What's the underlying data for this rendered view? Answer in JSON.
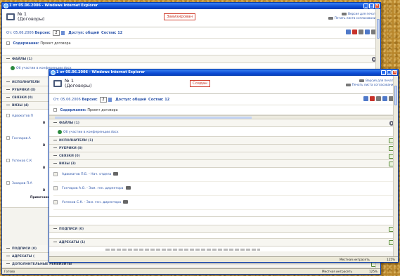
{
  "back_window": {
    "title": "1 от 05.06.2006 - Windows Internet Explorer",
    "doc_number": "№ 1",
    "doc_type": "(Договоры)",
    "status": "Завизирован",
    "print_version": "Версия для печати",
    "print_sheet": "Печать листа согласования",
    "meta_from": "От: 05.06.2006",
    "meta_version_label": "Версия:",
    "meta_version_value": "2",
    "meta_access": "Доступ: общий",
    "meta_composition": "Состав: 12",
    "content_label": "Содержание:",
    "content_value": "Проект договора",
    "files_header": "Файлы (1)",
    "file_name": "Об участии в конференции.docx",
    "left_sections": [
      "Исполнители",
      "Рубрики (0)",
      "Связки (0)",
      "Визы (4)"
    ],
    "left_visas": [
      "Адвокатов П",
      "Гончаров А",
      "Успехов С.К",
      "Захаров П.А"
    ],
    "left_visa_marks": [
      "В",
      "В",
      "В",
      "В"
    ],
    "left_visa_note": "Примечание",
    "bottom_sections": [
      "Подписи (0)",
      "Адресаты (",
      "Дополнительные реквизиты"
    ],
    "status_bar": "Готово",
    "zone": "Местная интрасеть",
    "zoom": "125%"
  },
  "front_window": {
    "title": "1 от 05.06.2006 - Windows Internet Explorer",
    "doc_number": "№ 1",
    "doc_type": "(Договоры)",
    "status": "Создан",
    "print_version": "Версия для печати",
    "print_sheet": "Печать листа согласования",
    "meta_from": "От: 05.06.2006",
    "meta_version_label": "Версия:",
    "meta_version_value": "2",
    "meta_access": "Доступ: общий",
    "meta_composition": "Состав: 12",
    "content_label": "Содержание:",
    "content_value": "Проект договора",
    "files_header": "Файлы (1)",
    "file_name": "Об участии в конференции.docx",
    "sections": {
      "executors": "Исполнители (1)",
      "rubrics": "Рубрики (0)",
      "links": "Связки (0)",
      "visas": "Визы (3)",
      "signatures": "Подписи (0)",
      "addressees": "Адресаты (1)"
    },
    "visas": [
      "Адвокатов П.Б. - Нач. отдела",
      "Гончаров А.О. - Зам. ген. директора",
      "Успехов С.К. - Зам. ген. директора"
    ],
    "zone": "Местная интрасеть",
    "zoom": "125%"
  }
}
